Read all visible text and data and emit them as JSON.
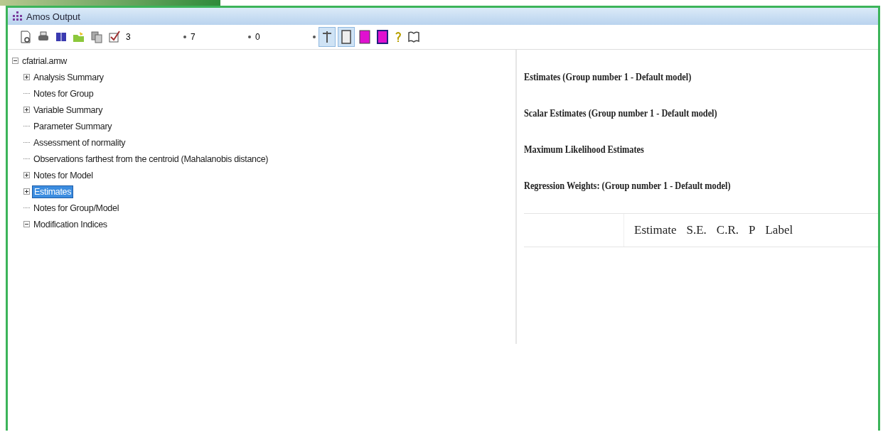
{
  "window": {
    "title": "Amos Output"
  },
  "toolbar": {
    "dropdowns": [
      {
        "value": "3"
      },
      {
        "value": "7"
      },
      {
        "value": "0"
      }
    ],
    "toggles": [
      {
        "kind": "line",
        "selected": true
      },
      {
        "kind": "frame",
        "selected": true
      },
      {
        "kind": "fill",
        "selected": false
      },
      {
        "kind": "fill2",
        "selected": false
      }
    ]
  },
  "tree": {
    "label": "cfatrial.amw",
    "expanded": true,
    "children": [
      {
        "label": "Analysis Summary",
        "kind": "branch",
        "expanded": false,
        "selected": false
      },
      {
        "label": "Notes for Group",
        "kind": "leaf",
        "selected": false
      },
      {
        "label": "Variable Summary",
        "kind": "branch",
        "expanded": false,
        "selected": false
      },
      {
        "label": "Parameter Summary",
        "kind": "leaf",
        "selected": false
      },
      {
        "label": "Assessment of normality",
        "kind": "leaf",
        "selected": false
      },
      {
        "label": "Observations farthest from the centroid (Mahalanobis distance)",
        "kind": "leaf",
        "selected": false
      },
      {
        "label": "Notes for Model",
        "kind": "branch",
        "expanded": false,
        "selected": false
      },
      {
        "label": "Estimates",
        "kind": "branch",
        "expanded": false,
        "selected": true
      },
      {
        "label": "Notes for Group/Model",
        "kind": "leaf",
        "selected": false
      },
      {
        "label": "Modification Indices",
        "kind": "branch",
        "expanded": true,
        "selected": false
      }
    ]
  },
  "output": {
    "headings": [
      "Estimates (Group number 1 - Default model)",
      "Scalar Estimates (Group number 1 - Default model)",
      "Maximum Likelihood Estimates",
      "Regression Weights: (Group number 1 - Default model)"
    ],
    "table": {
      "columns": [
        "Estimate",
        "S.E.",
        "C.R.",
        "P",
        "Label"
      ]
    }
  }
}
